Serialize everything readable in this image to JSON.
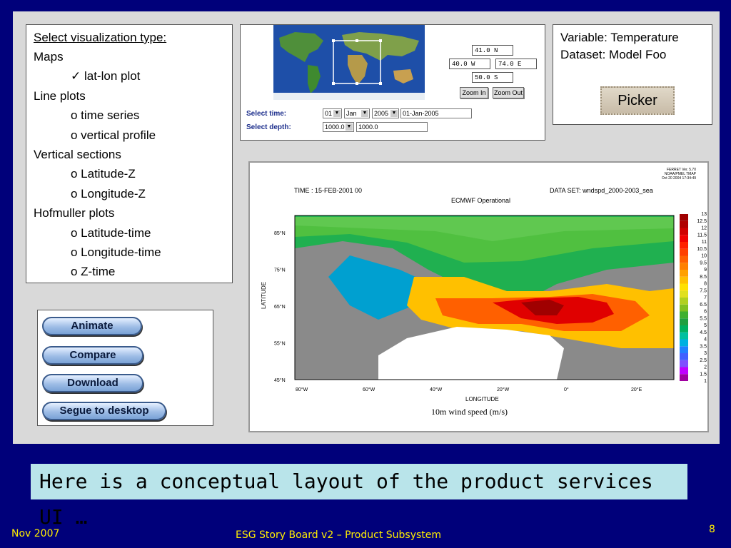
{
  "viz_type": {
    "heading": "Select visualization type:",
    "items": [
      {
        "text": "Maps",
        "indent": false
      },
      {
        "text": "✓ lat-lon plot",
        "indent": true
      },
      {
        "text": "Line plots",
        "indent": false
      },
      {
        "text": "o time series",
        "indent": true
      },
      {
        "text": "o vertical profile",
        "indent": true
      },
      {
        "text": "Vertical sections",
        "indent": false
      },
      {
        "text": "o Latitude-Z",
        "indent": true
      },
      {
        "text": "o Longitude-Z",
        "indent": true
      },
      {
        "text": "Hofmuller plots",
        "indent": false
      },
      {
        "text": "o Latitude-time",
        "indent": true
      },
      {
        "text": "o Longitude-time",
        "indent": true
      },
      {
        "text": "o Z-time",
        "indent": true
      }
    ]
  },
  "actions": {
    "animate": "Animate",
    "compare": "Compare",
    "download": "Download",
    "segue": "Segue to desktop"
  },
  "map_selector": {
    "north": "41.0 N",
    "west": "40.0 W",
    "east": "74.0 E",
    "south": "50.0 S",
    "zoom_in": "Zoom In",
    "zoom_out": "Zoom Out",
    "time_label": "Select time:",
    "depth_label": "Select depth:",
    "day": "01",
    "month": "Jan",
    "year": "2005",
    "date_text": "01-Jan-2005",
    "depth_select": "1000.0",
    "depth_text": "1000.0"
  },
  "variable_info": {
    "variable": "Variable: Temperature",
    "dataset": "Dataset: Model Foo",
    "picker": "Picker"
  },
  "plot": {
    "ferret_header": [
      "FERRET Ver. 5.70",
      "NOAA/PMEL TMAP",
      "Oct 20 2004 17:34:49"
    ],
    "time": "TIME : 15-FEB-2001 00",
    "dataset": "DATA SET: wndspd_2000-2003_sea",
    "title": "ECMWF Operational",
    "ylabel": "LATITUDE",
    "xlabel": "LONGITUDE",
    "units_title": "10m wind speed (m/s)",
    "lat_ticks": [
      "85°N",
      "75°N",
      "65°N",
      "55°N",
      "45°N"
    ],
    "lon_ticks": [
      "80°W",
      "60°W",
      "40°W",
      "20°W",
      "0°",
      "20°E"
    ],
    "colorbar_labels": [
      "13",
      "12.5",
      "12",
      "11.5",
      "11",
      "10.5",
      "10",
      "9.5",
      "9",
      "8.5",
      "8",
      "7.5",
      "7",
      "6.5",
      "6",
      "5.5",
      "5",
      "4.5",
      "4",
      "3.5",
      "3",
      "2.5",
      "2",
      "1.5",
      "1"
    ],
    "colors": {
      "land": "#8a8a8a",
      "scale": [
        "#a000a0",
        "#c000ff",
        "#8050ff",
        "#4060ff",
        "#2080ff",
        "#00b0e0",
        "#00c0a0",
        "#00b060",
        "#20a040",
        "#40b030",
        "#80c020",
        "#b0d020",
        "#e0e020",
        "#ffe000",
        "#ffc000",
        "#ffa000",
        "#ff8000",
        "#ff6000",
        "#ff4000",
        "#ff2000",
        "#f00000",
        "#d00000",
        "#b00000",
        "#a00000"
      ]
    }
  },
  "caption": "Here is a conceptual layout of the product services UI …",
  "footer": {
    "date": "Nov 2007",
    "title": "ESG Story Board v2 – Product Subsystem",
    "page": "8"
  }
}
